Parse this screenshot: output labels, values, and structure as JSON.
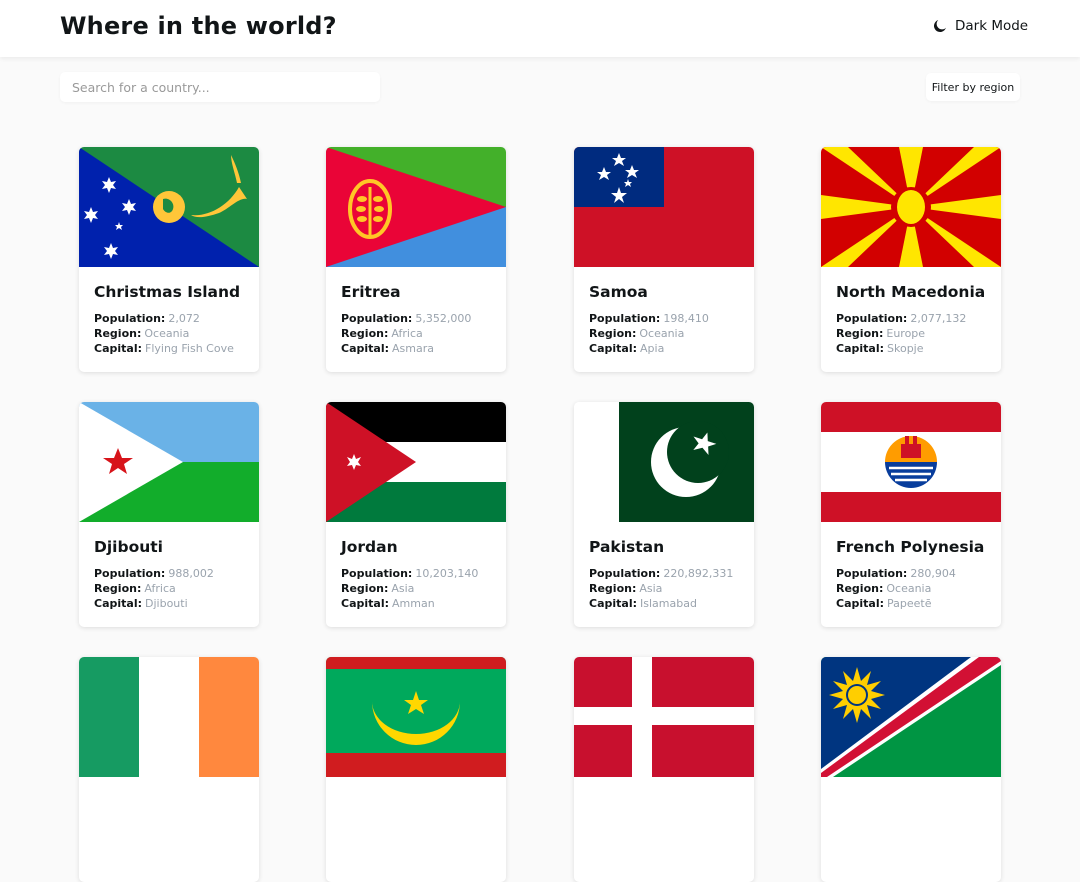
{
  "header": {
    "title": "Where in the world?",
    "dark_mode_label": "Dark Mode"
  },
  "search": {
    "placeholder": "Search for a country..."
  },
  "filter": {
    "label": "Filter by region"
  },
  "labels": {
    "population": "Population:",
    "region": "Region:",
    "capital": "Capital:"
  },
  "countries": [
    {
      "name": "Christmas Island",
      "population": "2,072",
      "region": "Oceania",
      "capital": "Flying Fish Cove"
    },
    {
      "name": "Eritrea",
      "population": "5,352,000",
      "region": "Africa",
      "capital": "Asmara"
    },
    {
      "name": "Samoa",
      "population": "198,410",
      "region": "Oceania",
      "capital": "Apia"
    },
    {
      "name": "North Macedonia",
      "population": "2,077,132",
      "region": "Europe",
      "capital": "Skopje"
    },
    {
      "name": "Djibouti",
      "population": "988,002",
      "region": "Africa",
      "capital": "Djibouti"
    },
    {
      "name": "Jordan",
      "population": "10,203,140",
      "region": "Asia",
      "capital": "Amman"
    },
    {
      "name": "Pakistan",
      "population": "220,892,331",
      "region": "Asia",
      "capital": "Islamabad"
    },
    {
      "name": "French Polynesia",
      "population": "280,904",
      "region": "Oceania",
      "capital": "Papeetē"
    },
    {
      "flag": "ireland-flag"
    },
    {
      "flag": "mauritania-flag"
    },
    {
      "flag": "denmark-flag"
    },
    {
      "flag": "namibia-flag"
    }
  ],
  "colors": {
    "background": "#fafafa",
    "text": "#111517",
    "muted": "#9aa3ad",
    "card": "#ffffff"
  }
}
